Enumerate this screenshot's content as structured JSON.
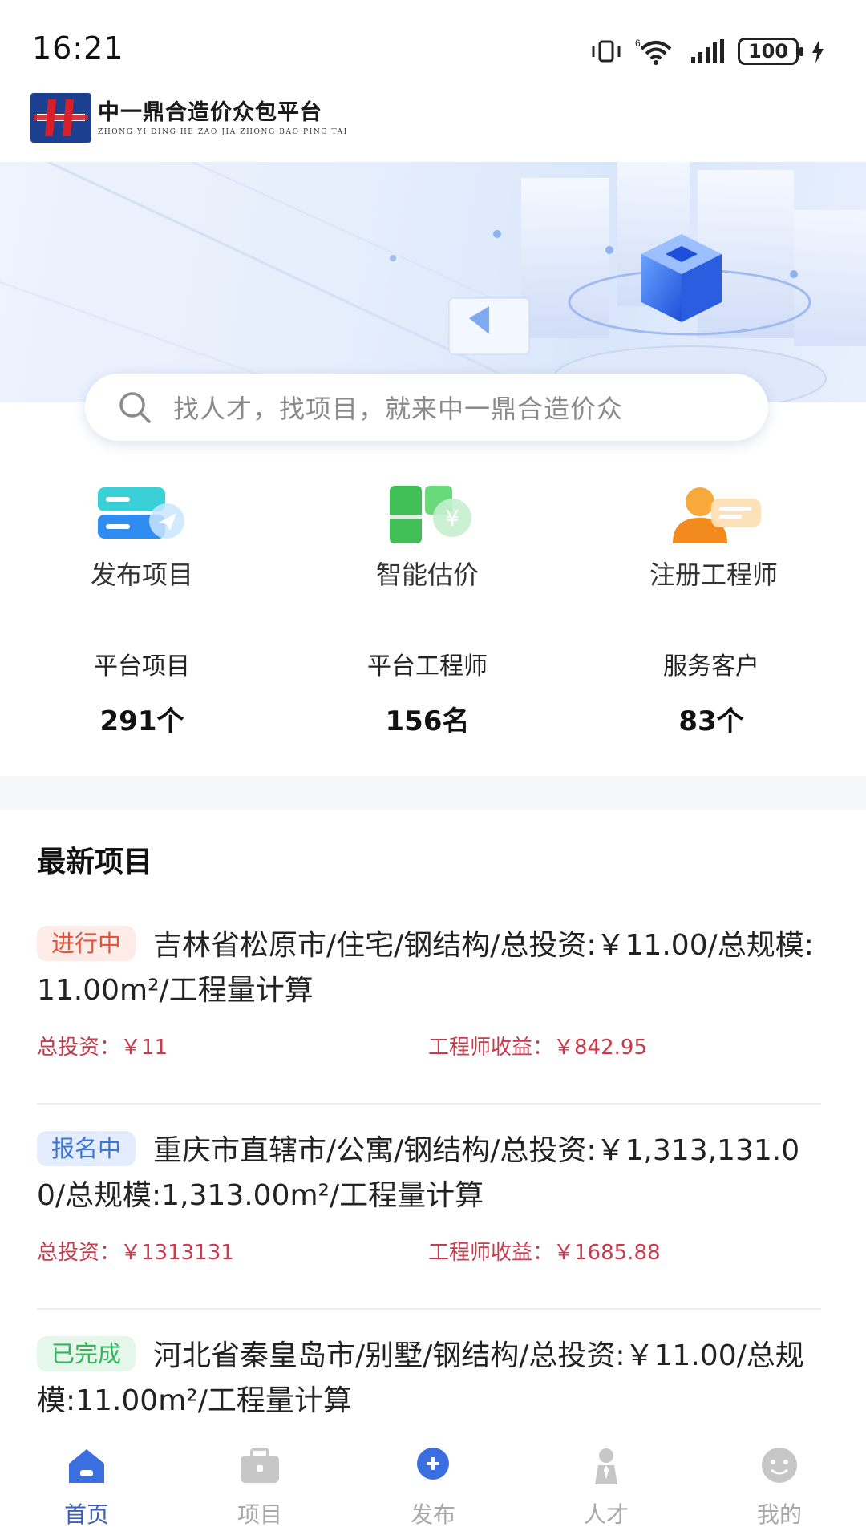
{
  "status_bar": {
    "time": "16:21",
    "network_label": "6",
    "battery": "100",
    "icons": [
      "vibrate-icon",
      "wifi-icon",
      "signal-icon",
      "battery-icon",
      "charging-icon"
    ]
  },
  "header": {
    "logo_text": "中一鼎合造价众包平台",
    "logo_subtext": "ZHONG YI DING HE ZAO JIA ZHONG BAO PING TAI"
  },
  "search": {
    "placeholder": "找人才，找项目，就来中一鼎合造价众"
  },
  "quick_actions": [
    {
      "label": "发布项目",
      "icon": "publish-project-icon"
    },
    {
      "label": "智能估价",
      "icon": "smart-valuation-icon"
    },
    {
      "label": "注册工程师",
      "icon": "register-engineer-icon"
    }
  ],
  "stats": [
    {
      "label": "平台项目",
      "value": "291个"
    },
    {
      "label": "平台工程师",
      "value": "156名"
    },
    {
      "label": "服务客户",
      "value": "83个"
    }
  ],
  "latest_projects": {
    "title": "最新项目",
    "items": [
      {
        "status": "进行中",
        "title": "吉林省松原市/住宅/钢结构/总投资:￥11.00/总规模:11.00m²/工程量计算",
        "investment_label": "总投资：",
        "investment": "￥11",
        "income_label": "工程师收益：",
        "income": "￥842.95"
      },
      {
        "status": "报名中",
        "title": "重庆市直辖市/公寓/钢结构/总投资:￥1,313,131.00/总规模:1,313.00m²/工程量计算",
        "investment_label": "总投资：",
        "investment": "￥1313131",
        "income_label": "工程师收益：",
        "income": "￥1685.88"
      },
      {
        "status": "已完成",
        "title": "河北省秦皇岛市/别墅/钢结构/总投资:￥11.00/总规模:11.00m²/工程量计算"
      }
    ]
  },
  "tab_bar": {
    "active": "首页",
    "tabs": [
      {
        "label": "首页",
        "icon": "home-icon"
      },
      {
        "label": "项目",
        "icon": "briefcase-icon"
      },
      {
        "label": "发布",
        "icon": "add-icon"
      },
      {
        "label": "人才",
        "icon": "talent-icon"
      },
      {
        "label": "我的",
        "icon": "profile-icon"
      }
    ]
  },
  "colors": {
    "accent": "#3b5fbf",
    "money": "#c93a4c",
    "tag_ongoing": "#e2553a",
    "tag_signup": "#3d74d8",
    "tag_done": "#35b45e"
  }
}
